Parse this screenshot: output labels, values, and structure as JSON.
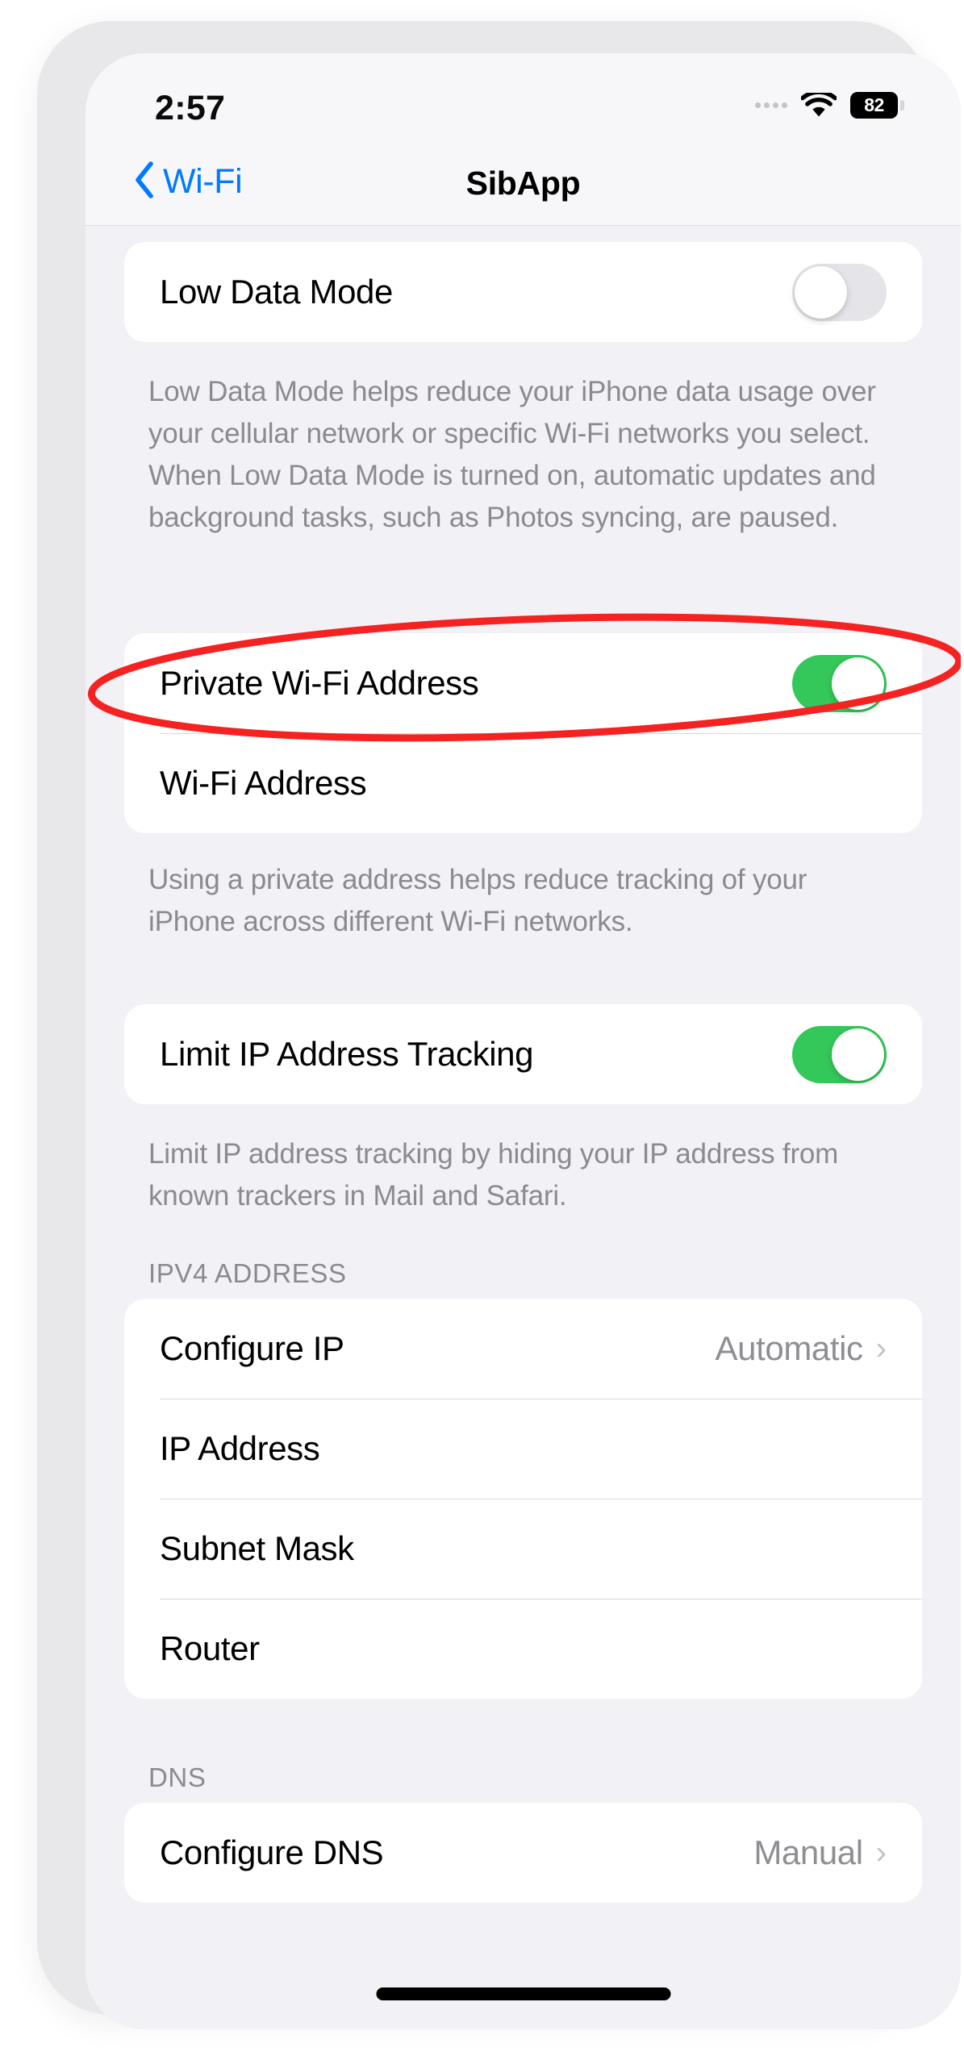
{
  "status_bar": {
    "time": "2:57",
    "cellular_icon": "cellular-dots-icon",
    "wifi_icon": "wifi-icon",
    "battery_level": "82"
  },
  "nav": {
    "back_label": "Wi-Fi",
    "back_icon": "chevron-left-icon",
    "title": "SibApp"
  },
  "sections": {
    "low_data": {
      "row_label": "Low Data Mode",
      "toggle_state": "off",
      "footer": "Low Data Mode helps reduce your iPhone data usage over your cellular network or specific Wi-Fi networks you select. When Low Data Mode is turned on, automatic updates and background tasks, such as Photos syncing, are paused."
    },
    "private_address": {
      "private_label": "Private Wi-Fi Address",
      "private_toggle_state": "on",
      "wifi_address_label": "Wi-Fi Address",
      "wifi_address_value": "",
      "footer": "Using a private address helps reduce tracking of your iPhone across different Wi-Fi networks."
    },
    "limit_ip": {
      "row_label": "Limit IP Address Tracking",
      "toggle_state": "on",
      "footer": "Limit IP address tracking by hiding your IP address from known trackers in Mail and Safari."
    },
    "ipv4": {
      "header": "IPV4 ADDRESS",
      "rows": [
        {
          "label": "Configure IP",
          "value": "Automatic",
          "has_chevron": true,
          "redacted": false
        },
        {
          "label": "IP Address",
          "value": "",
          "has_chevron": false,
          "redacted": true
        },
        {
          "label": "Subnet Mask",
          "value": "",
          "has_chevron": false,
          "redacted": true
        },
        {
          "label": "Router",
          "value": "",
          "has_chevron": false,
          "redacted": true
        }
      ]
    },
    "dns": {
      "header": "DNS",
      "row_label": "Configure DNS",
      "row_value": "Manual"
    }
  },
  "annotation": {
    "shape": "ellipse",
    "color": "#f52222",
    "target": "Private Wi-Fi Address"
  },
  "colors": {
    "accent_blue": "#007aff",
    "toggle_green": "#34c759",
    "background": "#f1f1f6",
    "card": "#ffffff",
    "secondary_text": "#8a8a8f"
  }
}
